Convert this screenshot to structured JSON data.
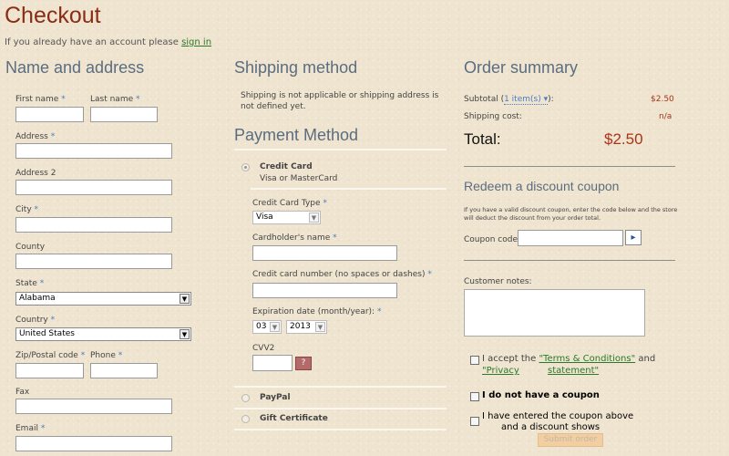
{
  "header": {
    "title": "Checkout",
    "account_text": "If you already have an account please",
    "sign_in": "sign in"
  },
  "name_address": {
    "heading": "Name and address",
    "first_name": "First name",
    "last_name": "Last name",
    "address": "Address",
    "address2": "Address 2",
    "city": "City",
    "county": "County",
    "state": "State",
    "state_value": "Alabama",
    "country": "Country",
    "country_value": "United States",
    "zip": "Zip/Postal code",
    "phone": "Phone",
    "fax": "Fax",
    "email": "Email",
    "required_mark": "*"
  },
  "shipping": {
    "heading": "Shipping method",
    "note": "Shipping is not applicable or shipping address is not defined yet."
  },
  "payment": {
    "heading": "Payment Method",
    "credit_card": "Credit Card",
    "credit_card_desc": "Visa or MasterCard",
    "card_type": "Credit Card Type",
    "card_type_value": "Visa",
    "cardholder": "Cardholder's name",
    "card_number": "Credit card number (no spaces or dashes)",
    "expiration": "Expiration date (month/year):",
    "exp_month": "03",
    "exp_year": "2013",
    "cvv2": "CVV2",
    "cvv_help": "?",
    "paypal": "PayPal",
    "gift": "Gift Certificate"
  },
  "summary": {
    "heading": "Order summary",
    "subtotal_label": "Subtotal (",
    "items": "1 item(s)",
    "subtotal_close": "):",
    "subtotal_value": "$2.50",
    "shipping_label": "Shipping cost:",
    "shipping_value": "n/a",
    "total_label": "Total:",
    "total_value": "$2.50"
  },
  "coupon": {
    "heading": "Redeem a discount coupon",
    "desc": "If you have a valid discount coupon, enter the code below and the store will deduct the discount from your order total.",
    "code_label": "Coupon code:",
    "go": "▸"
  },
  "notes": {
    "label": "Customer notes:"
  },
  "agree": {
    "accept_prefix": "I accept the",
    "terms": "\"Terms & Conditions\"",
    "and": "and",
    "privacy_1": "\"Privacy",
    "privacy_2": "statement\"",
    "no_coupon": "I do not have a coupon",
    "entered_1": "I have entered the coupon above",
    "entered_2": "and a discount shows"
  },
  "submit": "Submit order",
  "colors": {
    "title": "#8b2d14",
    "heading": "#5b6d80",
    "price": "#a8341a",
    "link": "#2a7a2a"
  }
}
